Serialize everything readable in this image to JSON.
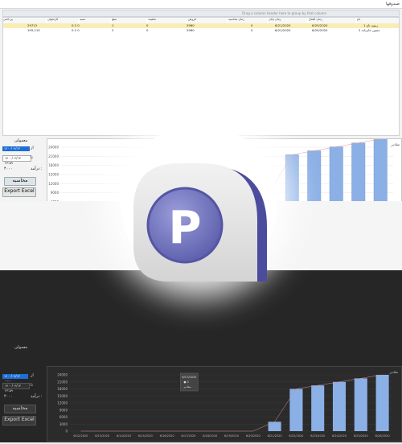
{
  "window": {
    "title": "صندوقها"
  },
  "grid": {
    "group_hint": "Drag a column header here to group by that column",
    "columns": [
      "نام",
      "زمان افتتاح",
      "زمان پایان",
      "زمان محاسبه",
      "فروش",
      "تخفیف",
      "مبلغ",
      "نسبه",
      "کارتخوان",
      "پرداختی"
    ],
    "rows": [
      [
        "1 زیتون تاج",
        "6/25/2020",
        "6/21/2020",
        "0",
        "",
        "2960",
        "0",
        "1",
        "0.2  0",
        "29713"
      ],
      [
        "2 حسین خان‌یاده",
        "6/25/2020",
        "6/21/2020",
        "0",
        "",
        "2960",
        "0",
        "2",
        "0.2  0",
        "105,115"
      ]
    ]
  },
  "side_panel": {
    "user_label": "معمولی",
    "from_label": "از",
    "to_label": "تا",
    "from_value": "۱۴۰۰/۰۴/۱۳ ۰۰:۰۰",
    "to_value": "۱۴۰۰/۰۴/۱۳ ۲۳:۵۹",
    "income_label": "درآمد :",
    "income_value": "۴۰۰۰",
    "calc_button": "محاسبه",
    "export_button": "Export Excel"
  },
  "chart_top": {
    "legend": "مقادیر",
    "y_ticks": [
      "24000",
      "21000",
      "18000",
      "15000",
      "12000",
      "9000",
      "6000"
    ]
  },
  "chart_data": {
    "type": "bar",
    "categories": [
      "6/12/2020",
      "6/13/2020",
      "6/14/2020",
      "6/15/2020",
      "6/16/2020",
      "6/17/2020",
      "6/18/2020",
      "6/19/2020",
      "6/20/2020",
      "6/21/2020",
      "6/22/2020",
      "6/23/2020",
      "6/24/2020",
      "6/25/2020",
      "6/26/2020"
    ],
    "values": [
      0,
      0,
      0,
      0,
      0,
      0,
      0,
      0,
      0,
      4000,
      18000,
      19500,
      21000,
      22500,
      24000
    ],
    "ylim": [
      0,
      24000
    ],
    "y_ticks": [
      "24000",
      "21000",
      "18000",
      "15000",
      "12000",
      "9000",
      "6000",
      "3000",
      "0"
    ],
    "tooltip": {
      "date": "6/17/2020",
      "series_name": "مقادیر",
      "value": "0"
    },
    "legend": "مقادیر"
  },
  "colors": {
    "bar": "#8bb0e6",
    "badge_outer": "#4b4c9c",
    "badge_inner": "#7476c4"
  }
}
